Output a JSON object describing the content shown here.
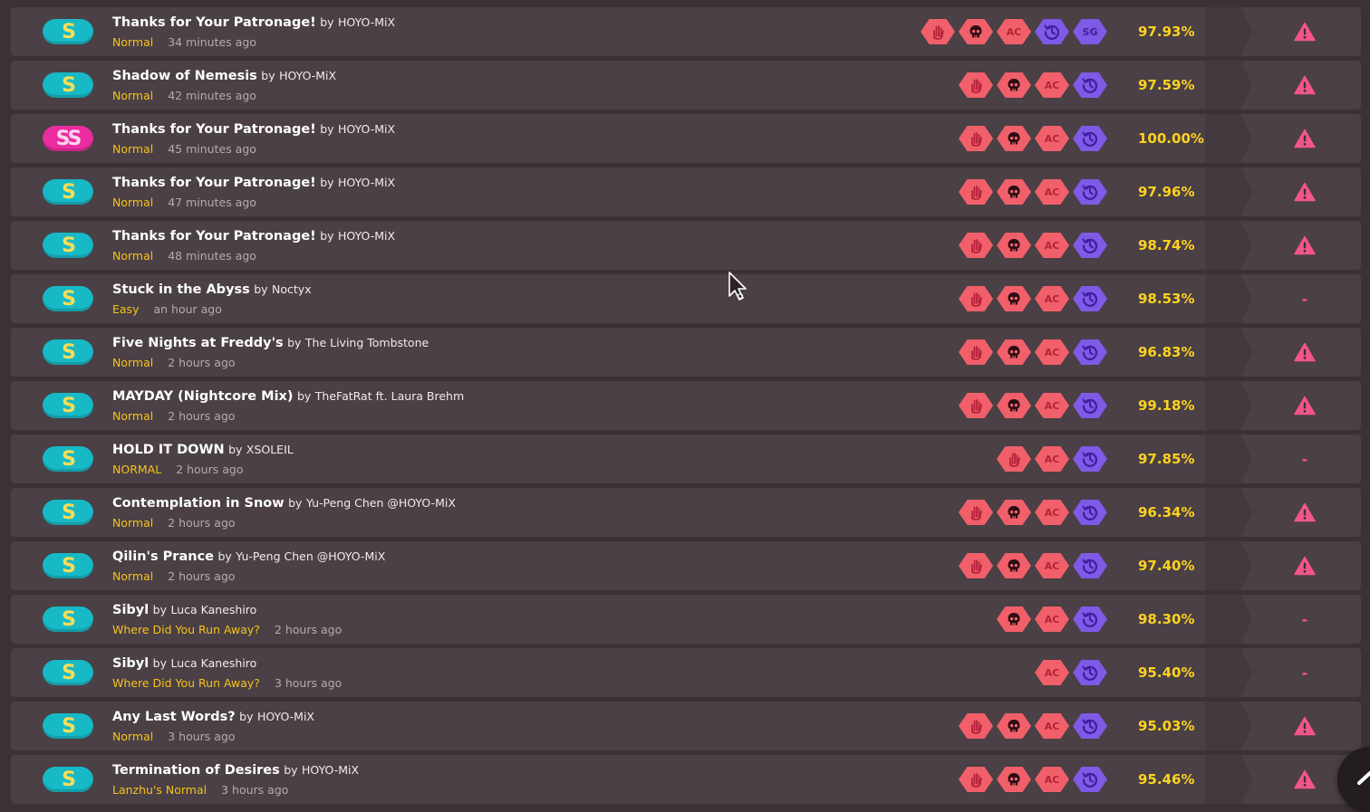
{
  "rows": [
    {
      "rank": "S",
      "song": "Thanks for Your Patronage!",
      "by": "by",
      "artist": "HOYO-MiX",
      "difficulty": "Normal",
      "time": "34 minutes ago",
      "mods": [
        {
          "kind": "hand",
          "color": "red"
        },
        {
          "kind": "skull",
          "color": "red"
        },
        {
          "kind": "ac",
          "label": "AC",
          "color": "red"
        },
        {
          "kind": "history",
          "color": "purple"
        },
        {
          "kind": "sg",
          "label": "SG",
          "color": "purple"
        }
      ],
      "accuracy": "97.93%",
      "action": "warning"
    },
    {
      "rank": "S",
      "song": "Shadow of Nemesis",
      "by": "by",
      "artist": "HOYO-MiX",
      "difficulty": "Normal",
      "time": "42 minutes ago",
      "mods": [
        {
          "kind": "hand",
          "color": "red"
        },
        {
          "kind": "skull",
          "color": "red"
        },
        {
          "kind": "ac",
          "label": "AC",
          "color": "red"
        },
        {
          "kind": "history",
          "color": "purple"
        }
      ],
      "accuracy": "97.59%",
      "action": "warning"
    },
    {
      "rank": "SS",
      "song": "Thanks for Your Patronage!",
      "by": "by",
      "artist": "HOYO-MiX",
      "difficulty": "Normal",
      "time": "45 minutes ago",
      "mods": [
        {
          "kind": "hand",
          "color": "red"
        },
        {
          "kind": "skull",
          "color": "red"
        },
        {
          "kind": "ac",
          "label": "AC",
          "color": "red"
        },
        {
          "kind": "history",
          "color": "purple"
        }
      ],
      "accuracy": "100.00%",
      "action": "warning"
    },
    {
      "rank": "S",
      "song": "Thanks for Your Patronage!",
      "by": "by",
      "artist": "HOYO-MiX",
      "difficulty": "Normal",
      "time": "47 minutes ago",
      "mods": [
        {
          "kind": "hand",
          "color": "red"
        },
        {
          "kind": "skull",
          "color": "red"
        },
        {
          "kind": "ac",
          "label": "AC",
          "color": "red"
        },
        {
          "kind": "history",
          "color": "purple"
        }
      ],
      "accuracy": "97.96%",
      "action": "warning"
    },
    {
      "rank": "S",
      "song": "Thanks for Your Patronage!",
      "by": "by",
      "artist": "HOYO-MiX",
      "difficulty": "Normal",
      "time": "48 minutes ago",
      "mods": [
        {
          "kind": "hand",
          "color": "red"
        },
        {
          "kind": "skull",
          "color": "red"
        },
        {
          "kind": "ac",
          "label": "AC",
          "color": "red"
        },
        {
          "kind": "history",
          "color": "purple"
        }
      ],
      "accuracy": "98.74%",
      "action": "warning"
    },
    {
      "rank": "S",
      "song": "Stuck in the Abyss",
      "by": "by",
      "artist": "Noctyx",
      "difficulty": "Easy",
      "time": "an hour ago",
      "mods": [
        {
          "kind": "hand",
          "color": "red"
        },
        {
          "kind": "skull",
          "color": "red"
        },
        {
          "kind": "ac",
          "label": "AC",
          "color": "red"
        },
        {
          "kind": "history",
          "color": "purple"
        }
      ],
      "accuracy": "98.53%",
      "action": "-"
    },
    {
      "rank": "S",
      "song": "Five Nights at Freddy's",
      "by": "by",
      "artist": "The Living Tombstone",
      "difficulty": "Normal",
      "time": "2 hours ago",
      "mods": [
        {
          "kind": "hand",
          "color": "red"
        },
        {
          "kind": "skull",
          "color": "red"
        },
        {
          "kind": "ac",
          "label": "AC",
          "color": "red"
        },
        {
          "kind": "history",
          "color": "purple"
        }
      ],
      "accuracy": "96.83%",
      "action": "warning"
    },
    {
      "rank": "S",
      "song": "MAYDAY (Nightcore Mix)",
      "by": "by",
      "artist": "TheFatRat ft. Laura Brehm",
      "difficulty": "Normal",
      "time": "2 hours ago",
      "mods": [
        {
          "kind": "hand",
          "color": "red"
        },
        {
          "kind": "skull",
          "color": "red"
        },
        {
          "kind": "ac",
          "label": "AC",
          "color": "red"
        },
        {
          "kind": "history",
          "color": "purple"
        }
      ],
      "accuracy": "99.18%",
      "action": "warning"
    },
    {
      "rank": "S",
      "song": "HOLD IT DOWN",
      "by": "by",
      "artist": "XSOLEIL",
      "difficulty": "NORMAL",
      "time": "2 hours ago",
      "mods": [
        {
          "kind": "hand",
          "color": "red"
        },
        {
          "kind": "ac",
          "label": "AC",
          "color": "red"
        },
        {
          "kind": "history",
          "color": "purple"
        }
      ],
      "accuracy": "97.85%",
      "action": "-"
    },
    {
      "rank": "S",
      "song": "Contemplation in Snow",
      "by": "by",
      "artist": "Yu-Peng Chen @HOYO-MiX",
      "difficulty": "Normal",
      "time": "2 hours ago",
      "mods": [
        {
          "kind": "hand",
          "color": "red"
        },
        {
          "kind": "skull",
          "color": "red"
        },
        {
          "kind": "ac",
          "label": "AC",
          "color": "red"
        },
        {
          "kind": "history",
          "color": "purple"
        }
      ],
      "accuracy": "96.34%",
      "action": "warning"
    },
    {
      "rank": "S",
      "song": "Qilin's Prance",
      "by": "by",
      "artist": "Yu-Peng Chen @HOYO-MiX",
      "difficulty": "Normal",
      "time": "2 hours ago",
      "mods": [
        {
          "kind": "hand",
          "color": "red"
        },
        {
          "kind": "skull",
          "color": "red"
        },
        {
          "kind": "ac",
          "label": "AC",
          "color": "red"
        },
        {
          "kind": "history",
          "color": "purple"
        }
      ],
      "accuracy": "97.40%",
      "action": "warning"
    },
    {
      "rank": "S",
      "song": "Sibyl",
      "by": "by",
      "artist": "Luca Kaneshiro",
      "difficulty": "Where Did You Run Away?",
      "time": "2 hours ago",
      "mods": [
        {
          "kind": "skull",
          "color": "red"
        },
        {
          "kind": "ac",
          "label": "AC",
          "color": "red"
        },
        {
          "kind": "history",
          "color": "purple"
        }
      ],
      "accuracy": "98.30%",
      "action": "-"
    },
    {
      "rank": "S",
      "song": "Sibyl",
      "by": "by",
      "artist": "Luca Kaneshiro",
      "difficulty": "Where Did You Run Away?",
      "time": "3 hours ago",
      "mods": [
        {
          "kind": "ac",
          "label": "AC",
          "color": "red"
        },
        {
          "kind": "history",
          "color": "purple"
        }
      ],
      "accuracy": "95.40%",
      "action": "-"
    },
    {
      "rank": "S",
      "song": "Any Last Words?",
      "by": "by",
      "artist": "HOYO-MiX",
      "difficulty": "Normal",
      "time": "3 hours ago",
      "mods": [
        {
          "kind": "hand",
          "color": "red"
        },
        {
          "kind": "skull",
          "color": "red"
        },
        {
          "kind": "ac",
          "label": "AC",
          "color": "red"
        },
        {
          "kind": "history",
          "color": "purple"
        }
      ],
      "accuracy": "95.03%",
      "action": "warning"
    },
    {
      "rank": "S",
      "song": "Termination of Desires",
      "by": "by",
      "artist": "HOYO-MiX",
      "difficulty": "Lanzhu's Normal",
      "time": "3 hours ago",
      "mods": [
        {
          "kind": "hand",
          "color": "red"
        },
        {
          "kind": "skull",
          "color": "red"
        },
        {
          "kind": "ac",
          "label": "AC",
          "color": "red"
        },
        {
          "kind": "history",
          "color": "purple"
        }
      ],
      "accuracy": "95.46%",
      "action": "warning"
    }
  ],
  "colors": {
    "background": "#3b3237",
    "row": "#4a4045",
    "rank_s": "#17b9c6",
    "rank_ss": "#ea2ca0",
    "difficulty": "#f6c21a",
    "accuracy": "#ffd21f",
    "mod_red": "#f1606a",
    "mod_purple": "#7e5ae6",
    "warning": "#f2558c"
  },
  "scroll_top_button": {
    "icon": "chevron-up-icon"
  }
}
